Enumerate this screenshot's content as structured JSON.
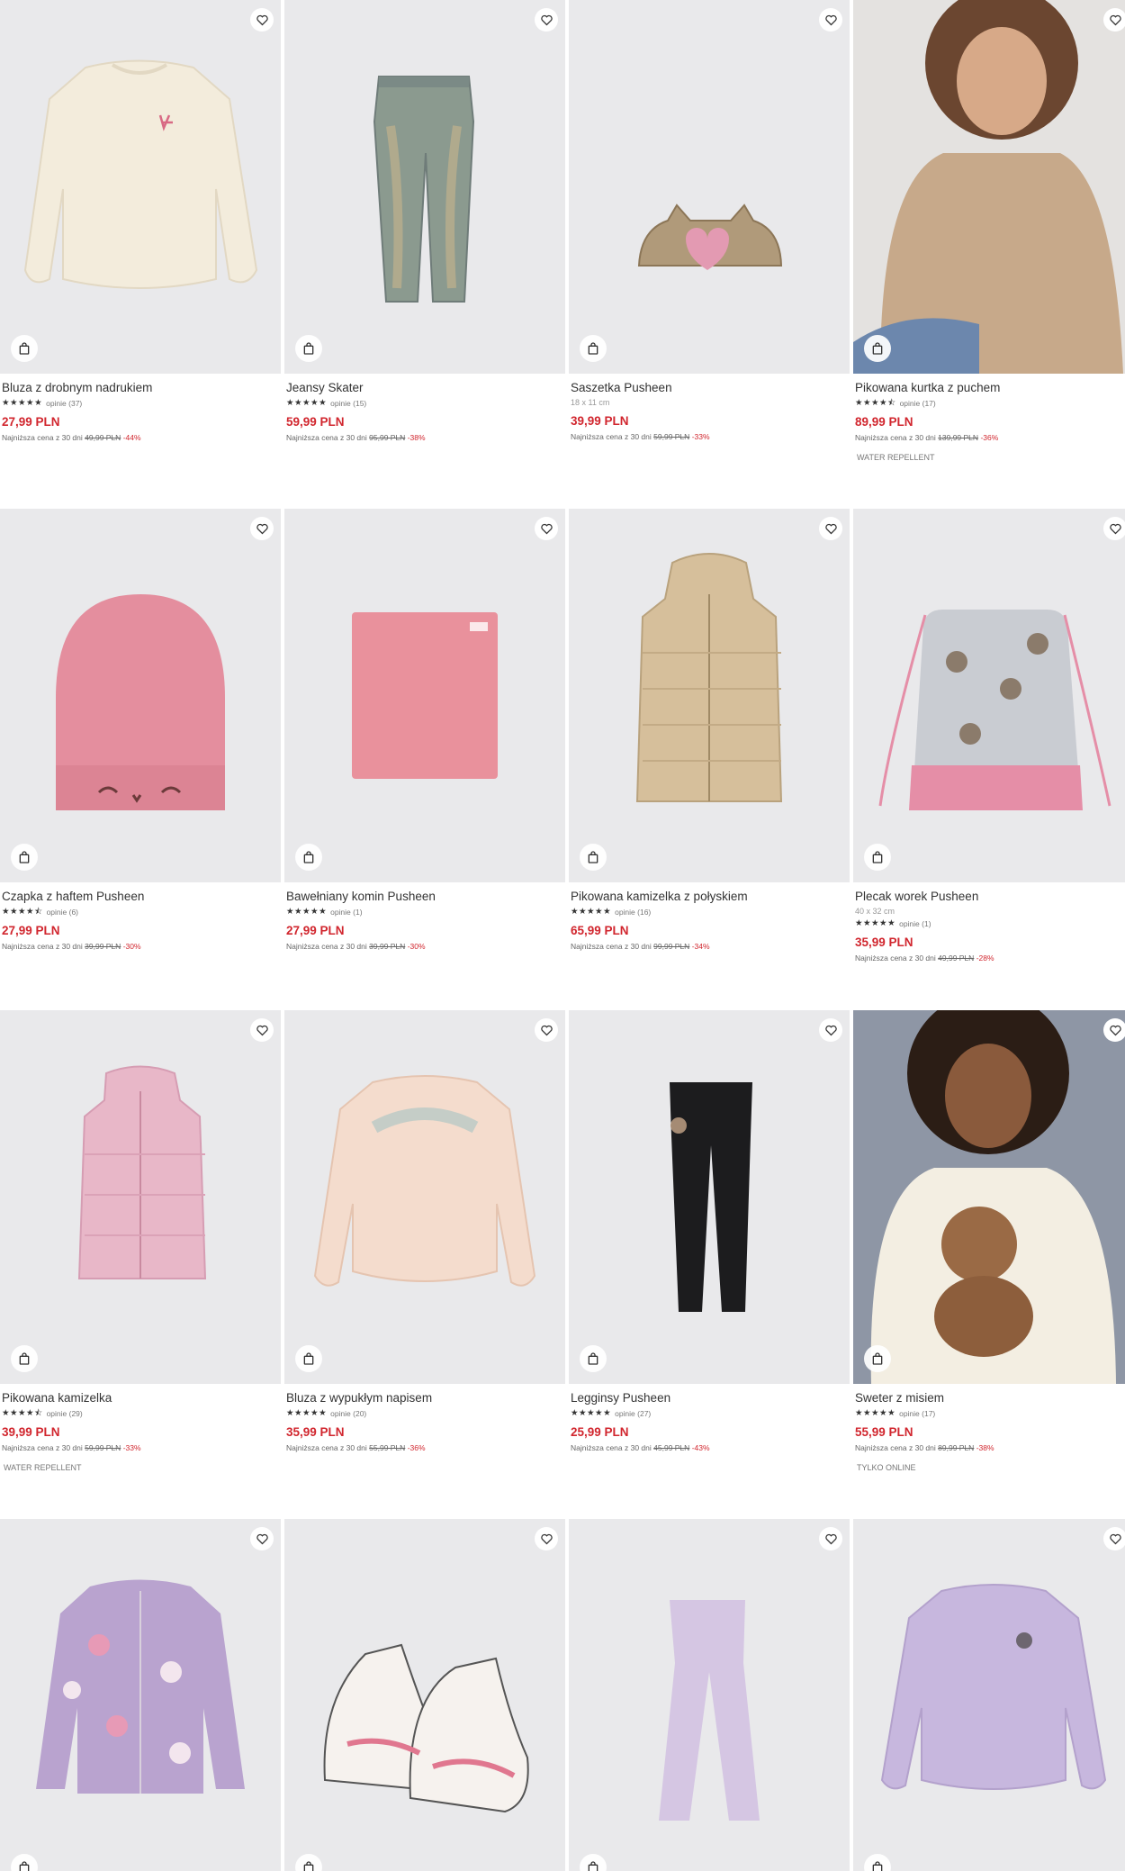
{
  "colors": {
    "price": "#d1262e",
    "text": "#333333",
    "photo_bg": "#e9e9eb"
  },
  "icons": {
    "favorite": "heart-icon",
    "cart": "shopping-bag-icon"
  },
  "products": [
    {
      "name": "Bluza z drobnym nadrukiem",
      "stars": "★★★★★",
      "reviews": "opinie (37)",
      "price": "27,99 PLN",
      "lowest_label": "Najniższa cena z 30 dni",
      "old_price": "49,99 PLN",
      "discount": "-44%"
    },
    {
      "name": "Jeansy Skater",
      "stars": "★★★★★",
      "reviews": "opinie (15)",
      "price": "59,99 PLN",
      "lowest_label": "Najniższa cena z 30 dni",
      "old_price": "95,99 PLN",
      "discount": "-38%"
    },
    {
      "name": "Saszetka Pusheen",
      "size": "18 x 11 cm",
      "price": "39,99 PLN",
      "lowest_label": "Najniższa cena z 30 dni",
      "old_price": "59,99 PLN",
      "discount": "-33%"
    },
    {
      "name": "Pikowana kurtka z puchem",
      "stars": "★★★★⯪",
      "reviews": "opinie (17)",
      "price": "89,99 PLN",
      "lowest_label": "Najniższa cena z 30 dni",
      "old_price": "139,99 PLN",
      "discount": "-36%",
      "tag": "WATER REPELLENT"
    },
    {
      "name": "Czapka z haftem Pusheen",
      "stars": "★★★★⯪",
      "reviews": "opinie (6)",
      "price": "27,99 PLN",
      "lowest_label": "Najniższa cena z 30 dni",
      "old_price": "39,99 PLN",
      "discount": "-30%"
    },
    {
      "name": "Bawełniany komin Pusheen",
      "stars": "★★★★★",
      "reviews": "opinie (1)",
      "price": "27,99 PLN",
      "lowest_label": "Najniższa cena z 30 dni",
      "old_price": "39,99 PLN",
      "discount": "-30%"
    },
    {
      "name": "Pikowana kamizelka z połyskiem",
      "stars": "★★★★★",
      "reviews": "opinie (16)",
      "price": "65,99 PLN",
      "lowest_label": "Najniższa cena z 30 dni",
      "old_price": "99,99 PLN",
      "discount": "-34%"
    },
    {
      "name": "Plecak worek Pusheen",
      "size": "40 x 32 cm",
      "stars": "★★★★★",
      "reviews": "opinie (1)",
      "price": "35,99 PLN",
      "lowest_label": "Najniższa cena z 30 dni",
      "old_price": "49,99 PLN",
      "discount": "-28%"
    },
    {
      "name": "Pikowana kamizelka",
      "stars": "★★★★⯪",
      "reviews": "opinie (29)",
      "price": "39,99 PLN",
      "lowest_label": "Najniższa cena z 30 dni",
      "old_price": "59,99 PLN",
      "discount": "-33%",
      "tag": "WATER REPELLENT"
    },
    {
      "name": "Bluza z wypukłym napisem",
      "stars": "★★★★★",
      "reviews": "opinie (20)",
      "price": "35,99 PLN",
      "lowest_label": "Najniższa cena z 30 dni",
      "old_price": "55,99 PLN",
      "discount": "-36%"
    },
    {
      "name": "Legginsy Pusheen",
      "stars": "★★★★★",
      "reviews": "opinie (27)",
      "price": "25,99 PLN",
      "lowest_label": "Najniższa cena z 30 dni",
      "old_price": "45,99 PLN",
      "discount": "-43%"
    },
    {
      "name": "Sweter z misiem",
      "stars": "★★★★★",
      "reviews": "opinie (17)",
      "price": "55,99 PLN",
      "lowest_label": "Najniższa cena z 30 dni",
      "old_price": "89,99 PLN",
      "discount": "-38%",
      "tag": "TYLKO ONLINE"
    },
    {
      "name": ""
    },
    {
      "name": ""
    },
    {
      "name": ""
    },
    {
      "name": ""
    }
  ]
}
